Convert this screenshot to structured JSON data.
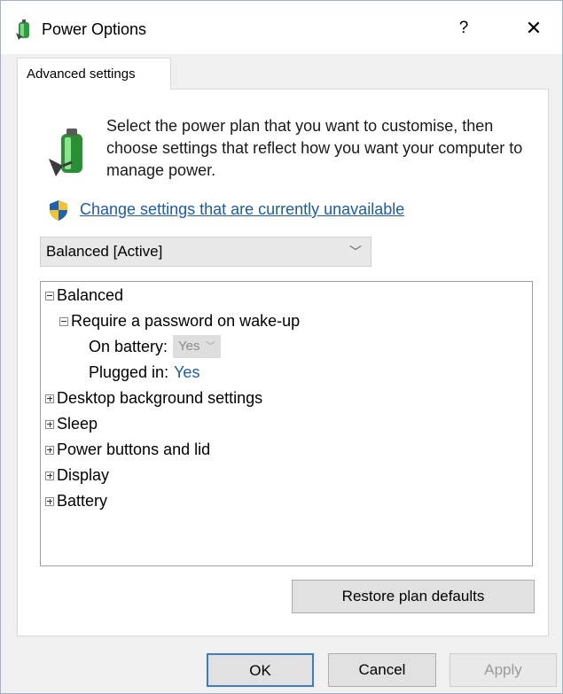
{
  "window": {
    "title": "Power Options",
    "help_label": "?",
    "close_label": "✕"
  },
  "tab": {
    "label": "Advanced settings"
  },
  "description": "Select the power plan that you want to customise, then choose settings that reflect how you want your computer to manage power.",
  "change_link": "Change settings that are currently unavailable",
  "plan_select": {
    "value": "Balanced [Active]"
  },
  "tree": {
    "root": "Balanced",
    "require_password": "Require a password on wake-up",
    "on_battery_label": "On battery:",
    "on_battery_value": "Yes",
    "plugged_in_label": "Plugged in:",
    "plugged_in_value": "Yes",
    "items": [
      "Desktop background settings",
      "Sleep",
      "Power buttons and lid",
      "Display",
      "Battery"
    ]
  },
  "buttons": {
    "restore": "Restore plan defaults",
    "ok": "OK",
    "cancel": "Cancel",
    "apply": "Apply"
  },
  "colors": {
    "link": "#1a5bb0",
    "accent": "#3b7bd1"
  }
}
